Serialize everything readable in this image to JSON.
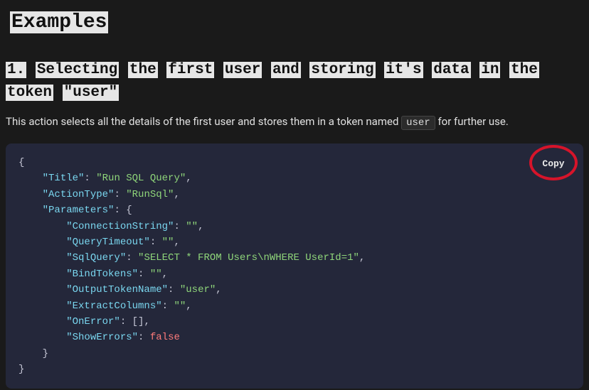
{
  "heading": "Examples",
  "subheading_words": [
    "1.",
    "Selecting",
    "the",
    "first",
    "user",
    "and",
    "storing",
    "it's",
    "data",
    "in",
    "the",
    "token",
    "\"user\""
  ],
  "description_pre": "This action selects all the details of the first user and stores them in a token named ",
  "description_token": "user",
  "description_post": " for further use.",
  "copy_label": "Copy",
  "code": {
    "Title": "Run SQL Query",
    "ActionType": "RunSql",
    "Parameters": {
      "ConnectionString": "",
      "QueryTimeout": "",
      "SqlQuery": "SELECT * FROM Users\\nWHERE UserId=1",
      "BindTokens": "",
      "OutputTokenName": "user",
      "ExtractColumns": "",
      "OnError": [],
      "ShowErrors": false
    }
  }
}
